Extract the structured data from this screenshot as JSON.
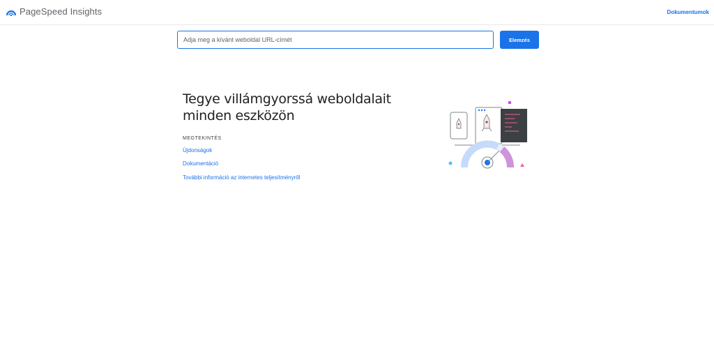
{
  "header": {
    "app_name": "PageSpeed Insights",
    "docs_link": "Dokumentumok",
    "logo_icon": "pagespeed-gauge-icon"
  },
  "search": {
    "placeholder": "Adja meg a kívánt weboldal URL-címét",
    "value": "",
    "button_label": "Elemzés"
  },
  "hero": {
    "title": "Tegye villámgyorssá weboldalait minden eszközön"
  },
  "overview": {
    "heading": "MEGTEKINTÉS",
    "links": [
      "Újdonságok",
      "Dokumentáció",
      "További információ az internetes teljesítményről"
    ]
  },
  "colors": {
    "accent": "#1a73e8",
    "text": "#202124",
    "muted": "#5f6368"
  }
}
